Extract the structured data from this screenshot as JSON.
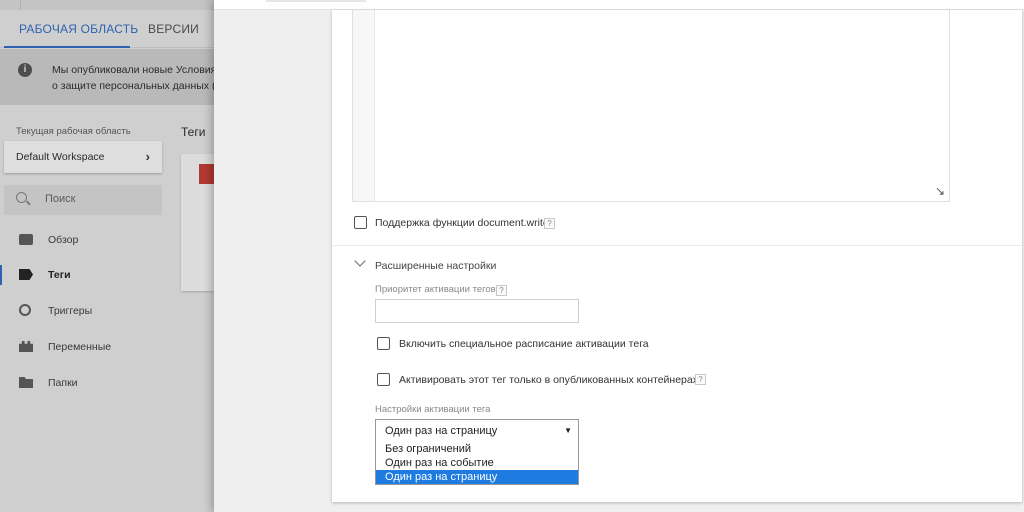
{
  "background_app": {
    "tabs": [
      {
        "label": "РАБОЧАЯ ОБЛАСТЬ",
        "active": true
      },
      {
        "label": "ВЕРСИИ",
        "active": false
      }
    ],
    "notice": {
      "line1": "Мы опубликовали новые Условия с",
      "line2": "о защите персональных данных (GI"
    },
    "workspace": {
      "caption": "Текущая рабочая область",
      "name": "Default Workspace"
    },
    "search": {
      "placeholder": "Поиск"
    },
    "nav": [
      {
        "label": "Обзор",
        "icon": "overview-icon",
        "active": false
      },
      {
        "label": "Теги",
        "icon": "tag-icon",
        "active": true
      },
      {
        "label": "Триггеры",
        "icon": "trigger-icon",
        "active": false
      },
      {
        "label": "Переменные",
        "icon": "variables-icon",
        "active": false
      },
      {
        "label": "Папки",
        "icon": "folder-icon",
        "active": false
      }
    ],
    "section_title": "Теги"
  },
  "tag_config": {
    "document_write": {
      "label": "Поддержка функции document.write",
      "checked": false
    },
    "advanced": {
      "title": "Расширенные настройки",
      "priority_label": "Приоритет активации тегов",
      "priority_value": "",
      "schedule": {
        "label": "Включить специальное расписание активации тега",
        "checked": false
      },
      "published_only": {
        "label": "Активировать этот тег только в опубликованных контейнерах.",
        "checked": false
      },
      "firing_options": {
        "label": "Настройки активации тега",
        "selected": "Один раз на страницу",
        "options": [
          "Без ограничений",
          "Один раз на событие",
          "Один раз на страницу"
        ]
      }
    },
    "help_glyph": "?"
  },
  "colors": {
    "accent": "#2f62b0",
    "dropdown_highlight": "#1e7be0",
    "tag_red": "#b03a31"
  }
}
